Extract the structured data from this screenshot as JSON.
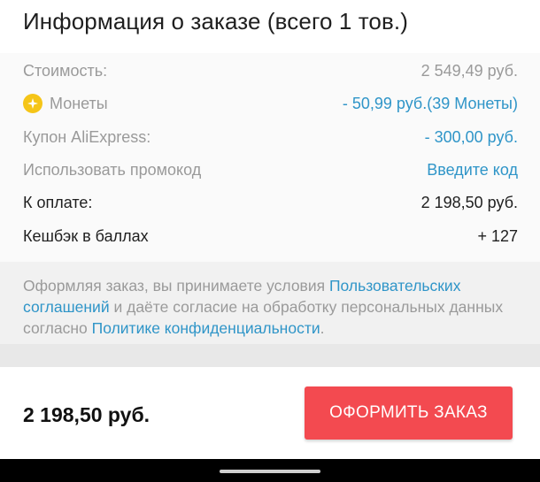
{
  "header": {
    "title": "Информация о заказе (всего 1 тов.)"
  },
  "summary": {
    "cost": {
      "label": "Стоимость:",
      "value": "2 549,49 руб."
    },
    "coins": {
      "label": "Монеты",
      "value": "- 50,99 руб.(39 Монеты)",
      "icon": "coin-icon"
    },
    "coupon": {
      "label": "Купон AliExpress:",
      "value": "- 300,00 руб."
    },
    "promo": {
      "label": "Использовать промокод",
      "action": "Введите код"
    },
    "to_pay": {
      "label": "К оплате:",
      "value": "2 198,50 руб."
    },
    "cashback": {
      "label": "Кешбэк в баллах",
      "value": "+ 127"
    }
  },
  "terms": {
    "part1": "Оформляя заказ, вы принимаете условия ",
    "link1": "Пользовательских соглашений",
    "part2": " и даёте согласие на обработку персональных данных согласно ",
    "link2": "Политике конфиденциальности",
    "part3": "."
  },
  "footer": {
    "total": "2 198,50 руб.",
    "checkout_label": "ОФОРМИТЬ ЗАКАЗ"
  },
  "colors": {
    "accent_blue": "#2f95c8",
    "checkout_red": "#f34a50",
    "coin_yellow": "#f5c518"
  }
}
